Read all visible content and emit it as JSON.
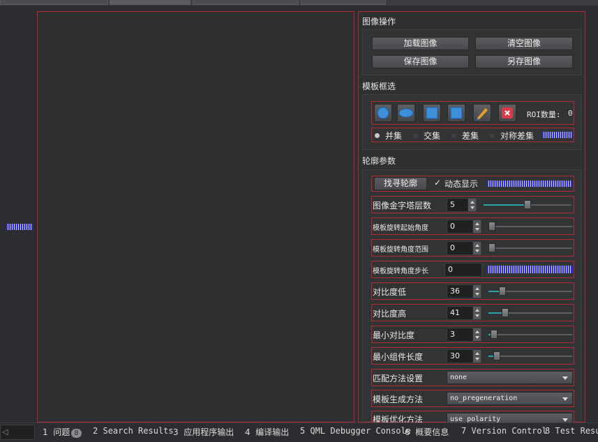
{
  "image_ops": {
    "title": "图像操作",
    "load_label": "加载图像",
    "clear_label": "清空图像",
    "save_label": "保存图像",
    "save_as_label": "另存图像"
  },
  "template_select": {
    "title": "模板框选",
    "roi_count_label": "ROI数量:",
    "roi_count_value": "0",
    "modes": [
      "并集",
      "交集",
      "差集",
      "对称差集"
    ],
    "selected_mode": "并集"
  },
  "contour_params": {
    "title": "轮廓参数",
    "find_contour_label": "找寻轮廓",
    "dynamic_display_label": "动态显示",
    "dynamic_display_checked": true,
    "rows": [
      {
        "label": "图像金字塔层数",
        "value": "5",
        "slider": 0.5
      },
      {
        "label": "模板旋转起始角度",
        "value": "0",
        "slider": 0.0
      },
      {
        "label": "模板旋转角度范围",
        "value": "0",
        "slider": 0.0
      },
      {
        "label": "模板旋转角度步长",
        "value": "0"
      },
      {
        "label": "对比度低",
        "value": "36",
        "slider": 0.18
      },
      {
        "label": "对比度高",
        "value": "41",
        "slider": 0.2
      },
      {
        "label": "最小对比度",
        "value": "3",
        "slider": 0.03
      },
      {
        "label": "最小组件长度",
        "value": "30",
        "slider": 0.1
      },
      {
        "label": "匹配方法设置",
        "value": "none"
      },
      {
        "label": "模板生成方法",
        "value": "no_pregeneration"
      },
      {
        "label": "模板优化方法",
        "value": "use_polarity"
      }
    ]
  },
  "statusbar": {
    "items": [
      {
        "num": "1",
        "label": "问题",
        "badge": "8"
      },
      {
        "num": "2",
        "label": "Search Results"
      },
      {
        "num": "3",
        "label": "应用程序输出"
      },
      {
        "num": "4",
        "label": "编译输出"
      },
      {
        "num": "5",
        "label": "QML Debugger Console"
      },
      {
        "num": "6",
        "label": "概要信息"
      },
      {
        "num": "7",
        "label": "Version Control"
      },
      {
        "num": "8",
        "label": "Test Results"
      }
    ]
  },
  "colors": {
    "accent": "#2aa4a8",
    "border_red": "#b32b32",
    "stripe_blue": "#2c2cd0"
  }
}
